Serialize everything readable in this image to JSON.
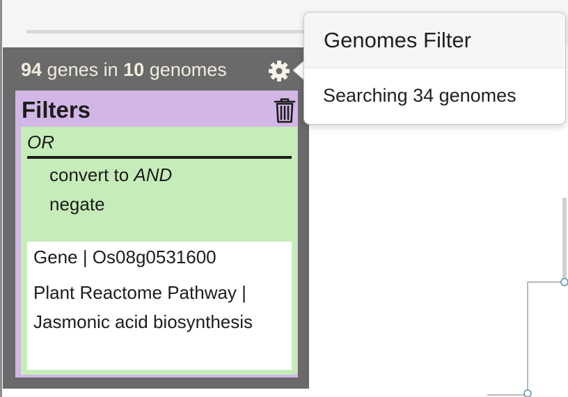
{
  "results": {
    "gene_count": "94",
    "genes_word": " genes in ",
    "genome_count": "10",
    "genomes_word": " genomes",
    "settings_icon": "gear-icon"
  },
  "filters": {
    "title": "Filters",
    "delete_icon": "trash-icon",
    "group": {
      "operator": "OR",
      "convert_prefix": "convert to ",
      "convert_target": "AND",
      "negate_label": "negate",
      "items": [
        {
          "label": "Gene | Os08g0531600"
        },
        {
          "label": "Plant Reactome Pathway | Jasmonic acid biosynthesis"
        }
      ]
    }
  },
  "popover": {
    "title": "Genomes Filter",
    "body": "Searching 34 genomes"
  },
  "colors": {
    "panel_dark": "#6a6a6a",
    "filters_purple": "#d2b6e6",
    "group_green": "#c6ecb9",
    "summary_text": "#f1ecdf"
  }
}
